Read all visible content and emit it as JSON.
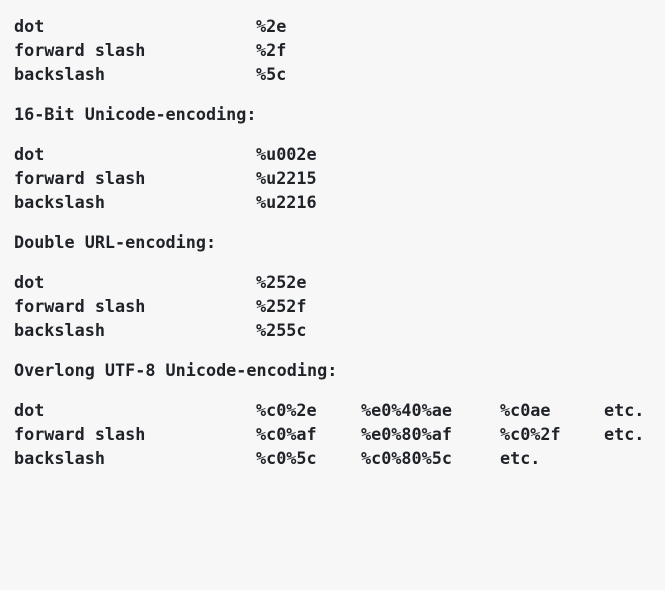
{
  "sections": [
    {
      "heading": "",
      "rows": [
        {
          "name": "dot",
          "values": [
            "%2e"
          ]
        },
        {
          "name": "forward slash",
          "values": [
            "%2f"
          ]
        },
        {
          "name": "backslash",
          "values": [
            "%5c"
          ]
        }
      ]
    },
    {
      "heading": "16-Bit Unicode-encoding:",
      "rows": [
        {
          "name": "dot",
          "values": [
            "%u002e"
          ]
        },
        {
          "name": "forward slash",
          "values": [
            "%u2215"
          ]
        },
        {
          "name": "backslash",
          "values": [
            "%u2216"
          ]
        }
      ]
    },
    {
      "heading": "Double URL-encoding:",
      "rows": [
        {
          "name": "dot",
          "values": [
            "%252e"
          ]
        },
        {
          "name": "forward slash",
          "values": [
            "%252f"
          ]
        },
        {
          "name": "backslash",
          "values": [
            "%255c"
          ]
        }
      ]
    },
    {
      "heading": "Overlong UTF-8 Unicode-encoding:",
      "rows": [
        {
          "name": "dot",
          "values": [
            "%c0%2e",
            "%e0%40%ae",
            "%c0ae",
            "etc."
          ]
        },
        {
          "name": "forward slash",
          "values": [
            "%c0%af",
            "%e0%80%af",
            "%c0%2f",
            "etc."
          ]
        },
        {
          "name": "backslash",
          "values": [
            "%c0%5c",
            "%c0%80%5c",
            "etc."
          ]
        }
      ]
    }
  ]
}
